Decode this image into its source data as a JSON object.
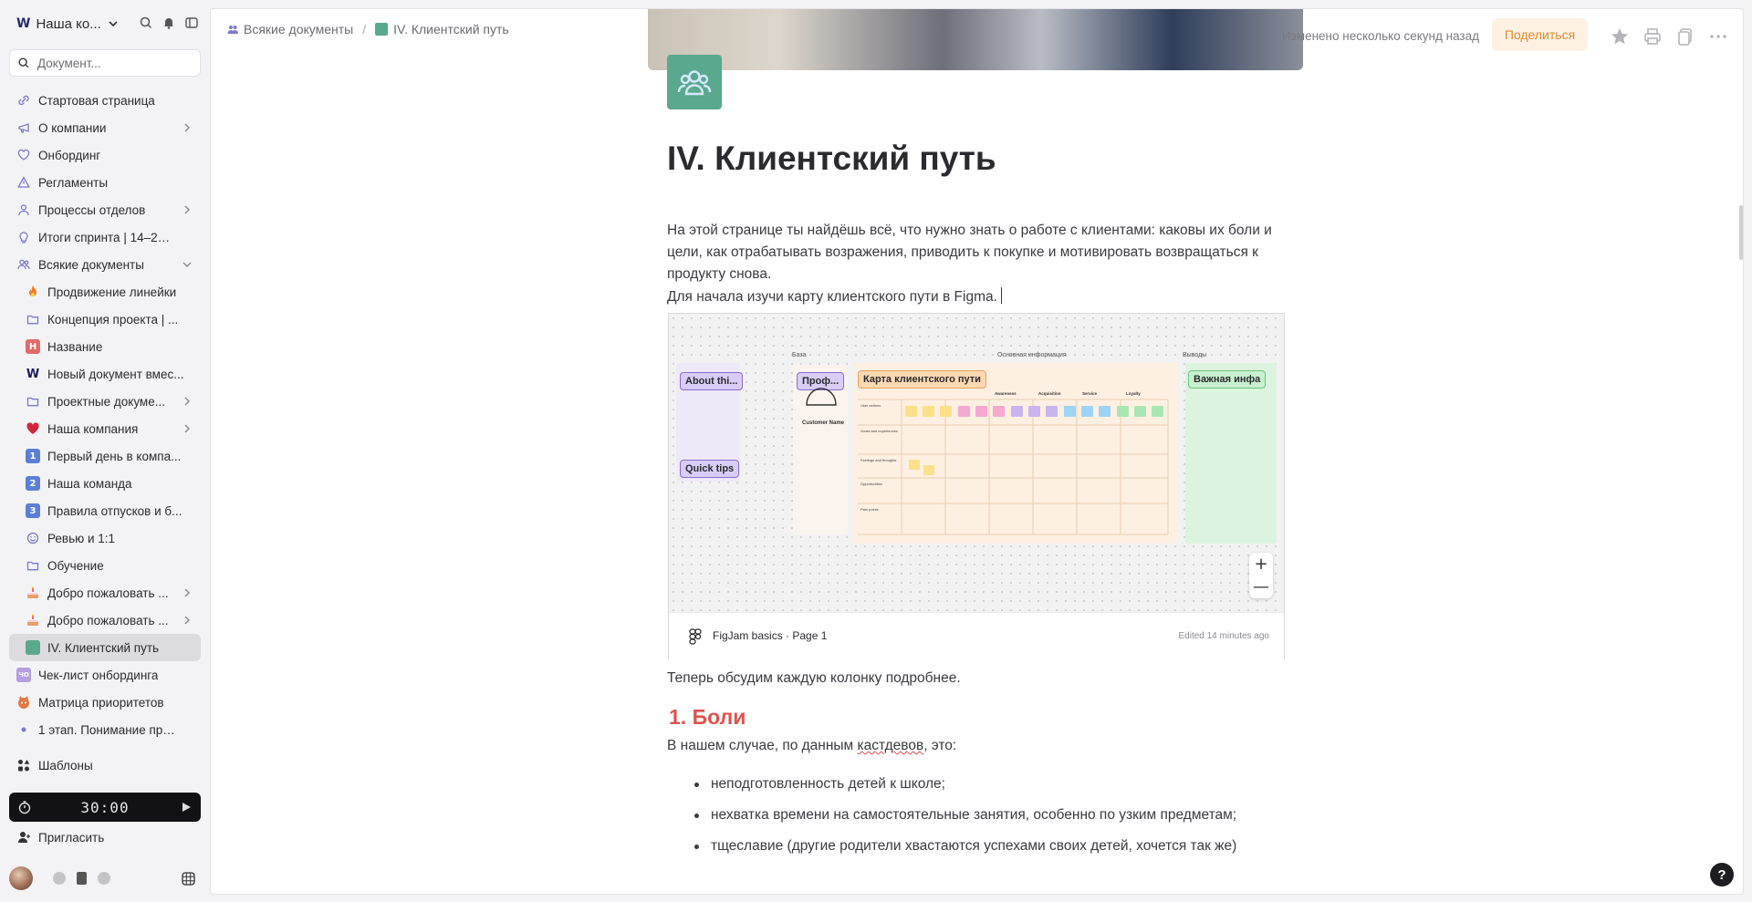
{
  "workspace": {
    "logo": "W",
    "name": "Наша ко..."
  },
  "search": {
    "placeholder": "Документ..."
  },
  "sidebar": {
    "items": [
      {
        "label": "Стартовая страница",
        "icon": "link-icon",
        "child": false,
        "chevron": false
      },
      {
        "label": "О компании",
        "icon": "megaphone-icon",
        "child": false,
        "chevron": true
      },
      {
        "label": "Онбординг",
        "icon": "heart-icon",
        "child": false,
        "chevron": false
      },
      {
        "label": "Регламенты",
        "icon": "warning-icon",
        "child": false,
        "chevron": false
      },
      {
        "label": "Процессы отделов",
        "icon": "user-icon",
        "child": false,
        "chevron": true
      },
      {
        "label": "Итоги спринта | 14–28 и...",
        "icon": "lightbulb-icon",
        "child": false,
        "chevron": false
      },
      {
        "label": "Всякие документы",
        "icon": "people-icon",
        "child": false,
        "chevron": "down"
      },
      {
        "label": "Продвижение линейки",
        "icon": "fire-icon",
        "child": true,
        "chevron": false
      },
      {
        "label": "Концепция проекта | ...",
        "icon": "folder-icon",
        "child": true,
        "chevron": false
      },
      {
        "label": "Название",
        "icon": "letter-h-icon",
        "badge": "H",
        "child": true,
        "chevron": false
      },
      {
        "label": "Новый документ вмес...",
        "icon": "w-logo-icon",
        "child": true,
        "chevron": false
      },
      {
        "label": "Проектные докуме...",
        "icon": "folder-icon",
        "child": true,
        "chevron": true
      },
      {
        "label": "Наша компания",
        "icon": "red-heart-icon",
        "child": true,
        "chevron": true
      },
      {
        "label": "Первый день в компа...",
        "icon": "number-1-icon",
        "badge": "1",
        "child": true,
        "chevron": false
      },
      {
        "label": "Наша команда",
        "icon": "number-2-icon",
        "badge": "2",
        "child": true,
        "chevron": false
      },
      {
        "label": "Правила отпусков и б...",
        "icon": "number-3-icon",
        "badge": "3",
        "child": true,
        "chevron": false
      },
      {
        "label": "Ревью и 1:1",
        "icon": "smile-icon",
        "child": true,
        "chevron": false
      },
      {
        "label": "Обучение",
        "icon": "folder-icon",
        "child": true,
        "chevron": false
      },
      {
        "label": "Добро пожаловать ...",
        "icon": "cake-icon",
        "child": true,
        "chevron": true
      },
      {
        "label": "Добро пожаловать ...",
        "icon": "cake-icon",
        "child": true,
        "chevron": true
      },
      {
        "label": "IV. Клиентский путь",
        "icon": "people-badge-icon",
        "child": true,
        "chevron": false,
        "active": true
      },
      {
        "label": "Чек-лист онбординга",
        "icon": "checklist-badge-icon",
        "badge": "ЧО",
        "child": false,
        "chevron": false
      },
      {
        "label": "Матрица приоритетов",
        "icon": "cat-icon",
        "child": false,
        "chevron": false
      },
      {
        "label": "1 этап. Понимание прои...",
        "icon": "dot-icon",
        "child": false,
        "chevron": false
      }
    ],
    "templates_label": "Шаблоны",
    "timer": "30:00",
    "invite_label": "Пригласить"
  },
  "topbar": {
    "breadcrumb_parent": "Всякие документы",
    "breadcrumb_current": "IV. Клиентский путь",
    "status": "Изменено несколько секунд назад",
    "share_label": "Поделиться"
  },
  "doc": {
    "title": "IV. Клиентский путь",
    "intro": "На этой странице ты найдёшь всё, что нужно знать о работе с клиентами: каковы их боли и цели, как отрабатывать возражения, приводить к покупке и мотивировать возвращаться к продукту снова.",
    "figma_line": "Для начала изучи карту клиентского пути в Figma.",
    "after_embed": "Теперь обсудим каждую колонку подробнее.",
    "h2": "1. Боли",
    "lead_before": "В нашем случае, по данным ",
    "lead_underlined": "кастдевов",
    "lead_after": ", это:",
    "bullets": [
      "неподготовленность детей к школе;",
      "нехватка времени на самостоятельные занятия, особенно по узким предметам;",
      "тщеславие (другие родители хвастаются успехами своих детей, хочется так же)"
    ]
  },
  "embed": {
    "file_name": "FigJam basics",
    "separator": "·",
    "page_name": "Page 1",
    "edited": "Edited 14 minutes ago",
    "zoom_in": "+",
    "zoom_out": "—",
    "board": {
      "section_base": "База",
      "section_main": "Основная информация",
      "section_conclusions": "Выводы",
      "about_sticker": "About thi...",
      "quick_tips_sticker": "Quick tips",
      "profile_sticker": "Проф...",
      "customer_name": "Customer Name",
      "map_title": "Карта клиентского пути",
      "important_sticker": "Важная инфа",
      "stages": [
        "Awareness",
        "Acquisition",
        "Service",
        "Loyalty"
      ],
      "rows": [
        "User actions",
        "Goals and experiences",
        "Feelings and thoughts",
        "Opportunities",
        "Pain points"
      ]
    }
  },
  "colors": {
    "accent_heading": "#e0524f",
    "share_bg": "#fdf1e3",
    "share_text": "#e08a2a",
    "doc_icon_bg": "#5aa88e"
  }
}
